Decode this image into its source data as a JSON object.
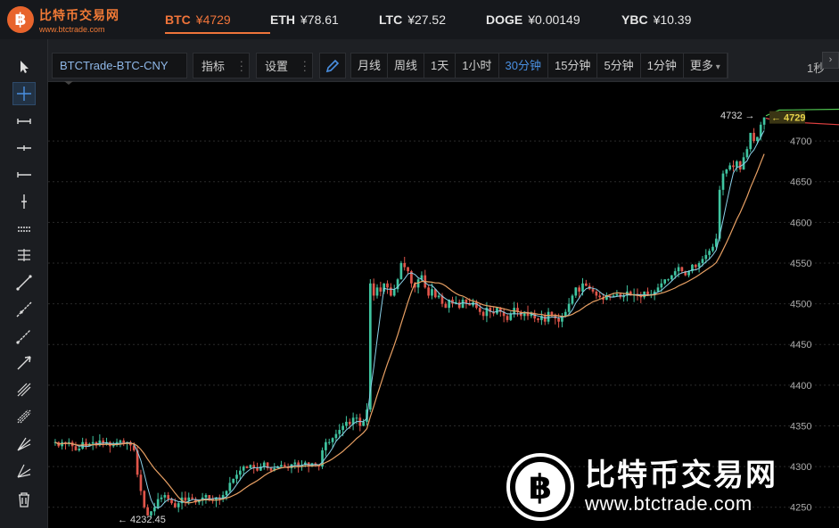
{
  "brand": {
    "name_cn": "比特币交易网",
    "url": "www.btctrade.com",
    "logo_glyph": "฿",
    "color": "#e8642c"
  },
  "tickers": [
    {
      "symbol": "BTC",
      "price": "¥4729",
      "active": true
    },
    {
      "symbol": "ETH",
      "price": "¥78.61",
      "active": false
    },
    {
      "symbol": "LTC",
      "price": "¥27.52",
      "active": false
    },
    {
      "symbol": "DOGE",
      "price": "¥0.00149",
      "active": false
    },
    {
      "symbol": "YBC",
      "price": "¥10.39",
      "active": false
    }
  ],
  "toolbar": {
    "symbol": "BTCTrade-BTC-CNY",
    "indicators_label": "指标",
    "settings_label": "设置",
    "periods": [
      "月线",
      "周线",
      "1天",
      "1小时",
      "30分钟",
      "15分钟",
      "5分钟",
      "1分钟",
      "更多"
    ],
    "selected_period": "30分钟",
    "right_label": "1秒"
  },
  "left_tools": [
    "cursor-icon",
    "crosshair-icon",
    "horizontal-ray-icon",
    "horizontal-line-icon",
    "horizontal-segment-icon",
    "vertical-line-icon",
    "fibonacci-icon",
    "parallel-lines-icon",
    "trend-line-icon",
    "extended-line-icon",
    "ray-line-icon",
    "arrow-line-icon",
    "gann-fan-icon",
    "pitchfork-icon",
    "fan-lines-icon",
    "speed-lines-icon",
    "trash-icon"
  ],
  "chart_data": {
    "type": "candlestick",
    "ylim": [
      4230,
      4745
    ],
    "yticks": [
      4250,
      4300,
      4350,
      4400,
      4450,
      4500,
      4550,
      4600,
      4650,
      4700
    ],
    "high_label": "4732 →",
    "low_label": "← 4232.45",
    "last_price_label": "← 4729",
    "last_price": 4729,
    "colors": {
      "up": "#3fc4a0",
      "down": "#e0554a",
      "ma_fast": "#8ad0e8",
      "ma_slow": "#e8a064",
      "grid": "#2a2a2a",
      "axis_text": "#aaa",
      "last_price_bg": "#e7d34a"
    },
    "closes": [
      4330,
      4325,
      4330,
      4328,
      4330,
      4325,
      4320,
      4322,
      4330,
      4325,
      4328,
      4330,
      4326,
      4332,
      4328,
      4330,
      4325,
      4327,
      4330,
      4332,
      4328,
      4330,
      4326,
      4320,
      4290,
      4270,
      4250,
      4240,
      4245,
      4250,
      4260,
      4262,
      4265,
      4260,
      4255,
      4250,
      4255,
      4262,
      4258,
      4262,
      4260,
      4256,
      4258,
      4262,
      4265,
      4260,
      4258,
      4262,
      4260,
      4265,
      4270,
      4280,
      4285,
      4290,
      4295,
      4300,
      4298,
      4302,
      4298,
      4295,
      4300,
      4305,
      4298,
      4295,
      4298,
      4300,
      4302,
      4300,
      4298,
      4303,
      4305,
      4300,
      4302,
      4305,
      4300,
      4304,
      4302,
      4300,
      4320,
      4330,
      4330,
      4335,
      4340,
      4345,
      4350,
      4355,
      4352,
      4360,
      4360,
      4350,
      4355,
      4370,
      4525,
      4510,
      4520,
      4515,
      4525,
      4520,
      4510,
      4518,
      4530,
      4550,
      4545,
      4540,
      4525,
      4520,
      4530,
      4535,
      4520,
      4510,
      4518,
      4508,
      4510,
      4500,
      4495,
      4505,
      4500,
      4502,
      4495,
      4505,
      4500,
      4498,
      4502,
      4495,
      4490,
      4485,
      4495,
      4490,
      4488,
      4495,
      4490,
      4485,
      4480,
      4488,
      4495,
      4490,
      4485,
      4490,
      4485,
      4488,
      4482,
      4480,
      4485,
      4478,
      4490,
      4485,
      4482,
      4478,
      4485,
      4490,
      4500,
      4510,
      4520,
      4515,
      4525,
      4522,
      4518,
      4515,
      4510,
      4508,
      4505,
      4510,
      4508,
      4510,
      4512,
      4508,
      4510,
      4515,
      4510,
      4512,
      4510,
      4508,
      4515,
      4510,
      4512,
      4515,
      4520,
      4525,
      4530,
      4530,
      4535,
      4540,
      4545,
      4540,
      4535,
      4540,
      4548,
      4545,
      4550,
      4555,
      4560,
      4565,
      4570,
      4580,
      4640,
      4660,
      4665,
      4670,
      4668,
      4675,
      4665,
      4680,
      4690,
      4710,
      4700,
      4705,
      4720,
      4729
    ]
  }
}
